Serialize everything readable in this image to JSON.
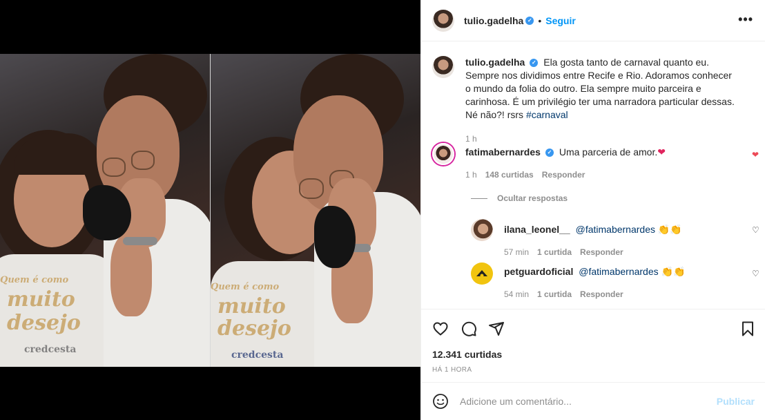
{
  "post": {
    "author": "tulio.gadelha",
    "follow_label": "Seguir",
    "more_label": "•••"
  },
  "caption": {
    "author": "tulio.gadelha",
    "text": "Ela gosta tanto de carnaval quanto eu. Sempre nos dividimos entre Recife e Rio. Adoramos conhecer o mundo da folia do outro. Ela sempre muito parceira e carinhosa. É um privilégio ter uma narradora particular dessas. Né não?! rsrs ",
    "hashtag": "#carnaval",
    "time": "1 h"
  },
  "comments": [
    {
      "author": "fatimabernardes",
      "text": "Uma parceria de amor.",
      "emoji": "❤",
      "time": "1 h",
      "likes": "148 curtidas",
      "reply_label": "Responder",
      "liked": true
    }
  ],
  "hide_replies_label": "Ocultar respostas",
  "replies": [
    {
      "author": "ilana_leonel__",
      "mention": "@fatimabernardes",
      "emoji": "👏👏",
      "time": "57 min",
      "likes": "1 curtida",
      "reply_label": "Responder"
    },
    {
      "author": "petguardoficial",
      "mention": "@fatimabernardes",
      "emoji": "👏👏",
      "time": "54 min",
      "likes": "1 curtida",
      "reply_label": "Responder"
    }
  ],
  "actions": {
    "likes_count": "12.341 curtidas",
    "posted_ago": "HÁ 1 HORA"
  },
  "add_comment": {
    "placeholder": "Adicione um comentário...",
    "publish_label": "Publicar"
  },
  "photo_print": {
    "shirt_text_1": "Quem é como",
    "shirt_text_2": "muito",
    "shirt_text_3": "desejo",
    "sponsor": "credcesta"
  },
  "colors": {
    "link_blue": "#0095f6",
    "hashtag_blue": "#00376b",
    "like_red": "#ed4956",
    "muted": "#8e8e8e",
    "publish_disabled": "#b2dffc"
  }
}
